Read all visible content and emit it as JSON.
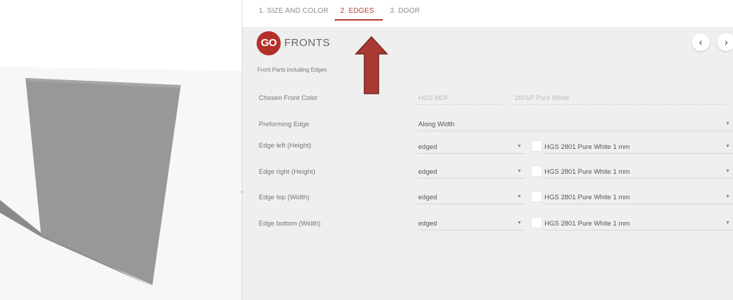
{
  "steps": [
    {
      "label": "1. SIZE AND COLOR"
    },
    {
      "label": "2. EDGES"
    },
    {
      "label": "3. DOOR"
    }
  ],
  "brand": {
    "logo_text": "GO",
    "name": "FRONTS",
    "accent_color": "#b5302b"
  },
  "subtitle": "Front Parts including Edges",
  "chosen_front_color": {
    "label": "Chosen Front Color",
    "material": "HGS MDF",
    "color": "2801P Pure White"
  },
  "preforming_edge": {
    "label": "Preforming Edge",
    "value": "Along Width"
  },
  "edges": [
    {
      "label": "Edge left (Height)",
      "type": "edged",
      "material": "HGS 2801 Pure White 1 mm"
    },
    {
      "label": "Edge right (Height)",
      "type": "edged",
      "material": "HGS 2801 Pure White 1 mm"
    },
    {
      "label": "Edge top (Width)",
      "type": "edged",
      "material": "HGS 2801 Pure White 1 mm"
    },
    {
      "label": "Edge bottom (Width)",
      "type": "edged",
      "material": "HGS 2801 Pure White 1 mm"
    }
  ],
  "icons": {
    "prev": "chevron-left-icon",
    "next": "chevron-right-icon",
    "annotation": "up-arrow-annotation",
    "splitter": "collapse-handle-icon"
  }
}
